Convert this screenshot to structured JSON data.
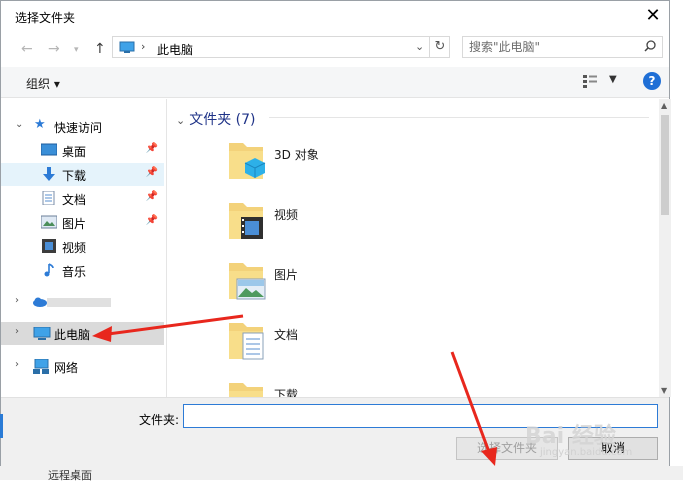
{
  "dialog": {
    "title": "选择文件夹"
  },
  "address": {
    "location": "此电脑",
    "separator": "›"
  },
  "search": {
    "placeholder": "搜索\"此电脑\""
  },
  "toolbar": {
    "organize_label": "组织 ▾",
    "help_label": "?"
  },
  "nav": {
    "quick_access": "快速访问",
    "items": [
      {
        "label": "桌面",
        "icon": "desktop-icon",
        "pinned": true
      },
      {
        "label": "下载",
        "icon": "download-icon",
        "pinned": true
      },
      {
        "label": "文档",
        "icon": "document-icon",
        "pinned": true
      },
      {
        "label": "图片",
        "icon": "picture-icon",
        "pinned": true
      },
      {
        "label": "视频",
        "icon": "video-icon",
        "pinned": false
      },
      {
        "label": "音乐",
        "icon": "music-icon",
        "pinned": false
      }
    ],
    "this_pc": "此电脑",
    "network": "网络"
  },
  "main": {
    "group_label": "文件夹 (7)",
    "folders": [
      {
        "label": "3D 对象",
        "icon": "3d-objects-folder-icon"
      },
      {
        "label": "视频",
        "icon": "video-folder-icon"
      },
      {
        "label": "图片",
        "icon": "pictures-folder-icon"
      },
      {
        "label": "文档",
        "icon": "documents-folder-icon"
      },
      {
        "label": "下载",
        "icon": "downloads-folder-icon"
      }
    ]
  },
  "footer": {
    "folder_label": "文件夹:",
    "folder_value": "",
    "select_button": "选择文件夹",
    "cancel_button": "取消"
  },
  "background": {
    "remote_desktop": "远程桌面"
  },
  "watermark": {
    "text": "Bai 经验",
    "sub": "jingyan.baidu.com"
  },
  "colors": {
    "accent": "#1f6fd6",
    "annotation_arrow": "#e8271d",
    "selection": "#dadada"
  }
}
